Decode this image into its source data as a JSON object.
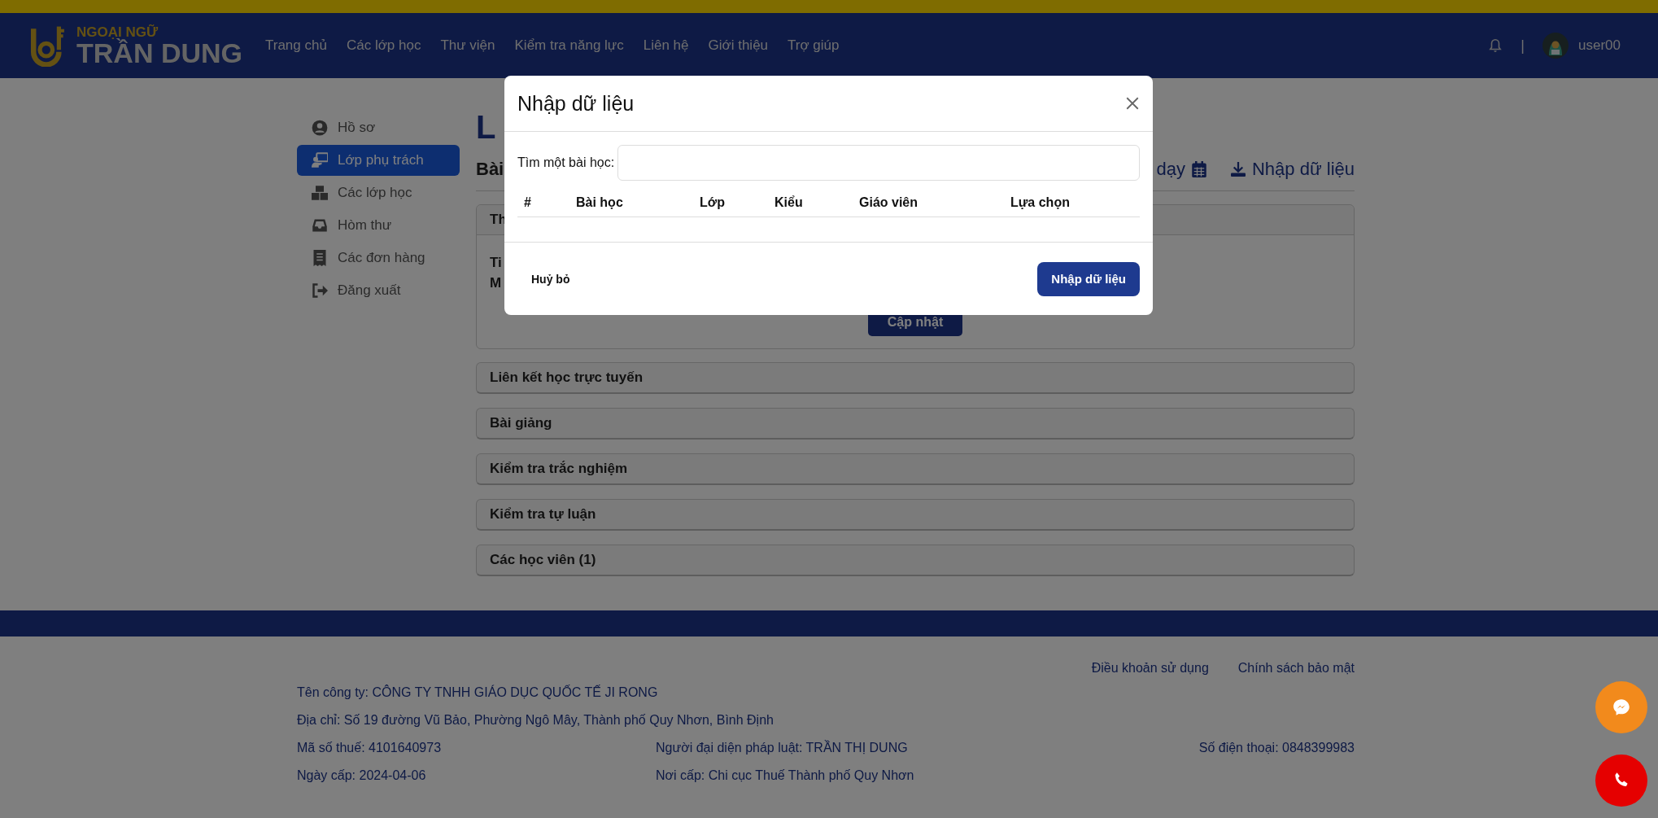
{
  "header": {
    "logo_small": "NGOẠI NGỮ",
    "logo_big": "TRẦN DUNG",
    "nav": [
      "Trang chủ",
      "Các lớp học",
      "Thư viện",
      "Kiểm tra năng lực",
      "Liên hệ",
      "Giới thiệu",
      "Trợ giúp"
    ],
    "separator": "|",
    "username": "user00"
  },
  "sidebar": {
    "items": [
      {
        "label": "Hồ sơ",
        "kind": "profile",
        "selected": false
      },
      {
        "label": "Lớp phụ trách",
        "kind": "classes",
        "selected": true
      },
      {
        "label": "Các lớp học",
        "kind": "catalog",
        "selected": false
      },
      {
        "label": "Hòm thư",
        "kind": "mail",
        "selected": false
      },
      {
        "label": "Các đơn hàng",
        "kind": "orders",
        "selected": false
      },
      {
        "label": "Đăng xuất",
        "kind": "logout",
        "selected": false
      }
    ]
  },
  "content": {
    "title": "L",
    "subtitle": "Bài",
    "schedule_link": "dạy",
    "import_link": "Nhập dữ liệu",
    "info_card": {
      "header": "Th",
      "lines": [
        "Ti",
        "M"
      ],
      "button": "Cập nhật"
    },
    "sections": [
      "Liên kết học trực tuyến",
      "Bài giảng",
      "Kiểm tra trắc nghiệm",
      "Kiểm tra tự luận",
      "Các học viên (1)"
    ]
  },
  "footer": {
    "links": [
      "Điều khoản sử dụng",
      "Chính sách bảo mật"
    ],
    "rows": [
      [
        "Tên công ty: CÔNG TY TNHH GIÁO DỤC QUỐC TẾ JI RONG"
      ],
      [
        "Địa chỉ: Số 19 đường Vũ Bảo, Phường Ngô Mây, Thành phố Quy Nhơn, Bình Định"
      ],
      [
        "Mã số thuế: 4101640973",
        "Người đại diện pháp luật: TRẦN THỊ DUNG",
        "Số điện thoại: 0848399983"
      ],
      [
        "Ngày cấp: 2024-04-06",
        "Nơi cấp: Chi cục Thuế Thành phố Quy Nhơn"
      ]
    ]
  },
  "modal": {
    "title": "Nhập dữ liệu",
    "search_label": "Tìm một bài học:",
    "columns": [
      "#",
      "Bài học",
      "Lớp",
      "Kiểu",
      "Giáo viên",
      "Lựa chọn"
    ],
    "cancel": "Huỷ bỏ",
    "confirm": "Nhập dữ liệu"
  }
}
